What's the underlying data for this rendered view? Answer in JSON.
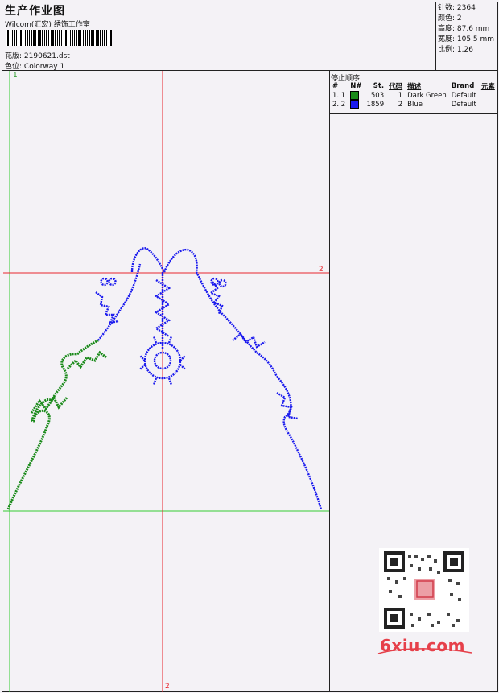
{
  "header": {
    "title": "生产作业图",
    "subtitle": "Wilcom(汇宏) 绣饰工作室",
    "design_label": "花版:",
    "design_value": "2190621.dst",
    "color_label": "色位:",
    "color_value": "Colorway 1"
  },
  "stats": {
    "stitches": "针数: 2364",
    "colors": "颜色: 2",
    "height": "高度: 87.6 mm",
    "width": "宽度: 105.5 mm",
    "ratio": "比例: 1.26"
  },
  "stop_sequence": {
    "title": "停止顺序:",
    "headers": [
      "#",
      "N#",
      "St.",
      "代码",
      "描述",
      "Brand",
      "元素"
    ],
    "rows": [
      {
        "seq": "1. 1",
        "color": "#1a8a1a",
        "stitches": "503",
        "code": "1",
        "desc": "Dark Green",
        "brand": "Default"
      },
      {
        "seq": "2. 2",
        "color": "#1a1aee",
        "stitches": "1859",
        "code": "2",
        "desc": "Blue",
        "brand": "Default"
      }
    ]
  },
  "axis_labels": {
    "top_left": "1",
    "right_marker": "2",
    "bottom_marker": "2"
  },
  "colors": {
    "grid_red": "#e8262e",
    "grid_green": "#33cc33",
    "stitch_green": "#1a8a1a",
    "stitch_blue": "#1a1aee"
  },
  "watermark": "6xiu.com"
}
